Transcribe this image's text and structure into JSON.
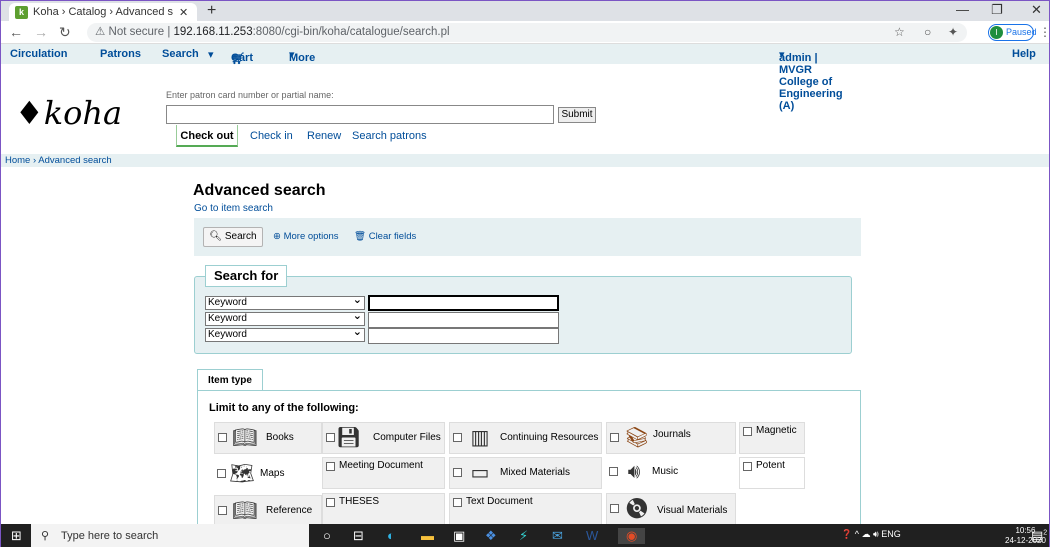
{
  "browser": {
    "tab_title": "Koha › Catalog › Advanced search",
    "tab_favicon": "k",
    "url_prefix": "Not secure",
    "url_host": "192.168.11.253",
    "url_rest": ":8080/cgi-bin/koha/catalogue/search.pl",
    "profile_badge": "Paused",
    "profile_initial": "I"
  },
  "kohanav": {
    "circulation": "Circulation",
    "patrons": "Patrons",
    "search": "Search",
    "cart": "Cart",
    "more": "More",
    "user": "admin | MVGR College of Engineering (A)",
    "help": "Help"
  },
  "header": {
    "logo": "koha",
    "patron_label": "Enter patron card number or partial name:",
    "submit": "Submit",
    "tabs": [
      "Check out",
      "Check in",
      "Renew",
      "Search patrons"
    ]
  },
  "breadcrumb": "Home › Advanced search",
  "main": {
    "title": "Advanced search",
    "item_search_link": "Go to item search",
    "toolbar": {
      "search": "Search",
      "more_options": "More options",
      "clear_fields": "Clear fields"
    },
    "search_for": "Search for",
    "index_options": [
      "Keyword",
      "Keyword",
      "Keyword"
    ]
  },
  "itemtype": {
    "tab": "Item type",
    "limit_label": "Limit to any of the following:",
    "types": [
      [
        "Books",
        "Computer Files",
        "Continuing Resources",
        "Journals",
        "Magnetic"
      ],
      [
        "Maps",
        "Meeting Document",
        "Mixed Materials",
        "Music",
        "Potent"
      ],
      [
        "Reference",
        "THESES",
        "Text Document",
        "Visual Materials"
      ]
    ]
  },
  "taskbar": {
    "search_placeholder": "Type here to search",
    "time": "10:56",
    "date": "24-12-2020",
    "lang": "ENG",
    "notif_count": "2"
  }
}
